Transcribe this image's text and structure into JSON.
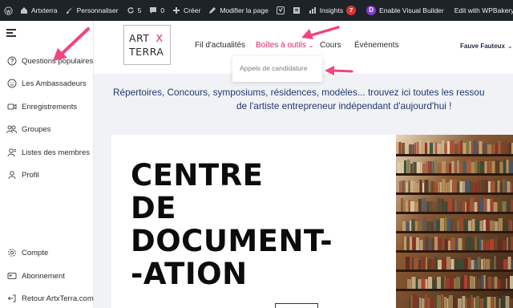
{
  "adminbar": {
    "site_name": "Artxterra",
    "customize": "Personnaliser",
    "updates_count": "5",
    "comments_count": "0",
    "new": "Créer",
    "edit_page": "Modifier la page",
    "insights": "Insights",
    "insights_badge": "7",
    "visual_builder": "Enable Visual Builder",
    "wpbakery": "Edit with WPBakery Page Builder",
    "divi_letter": "D"
  },
  "sidebar": {
    "items": [
      {
        "label": "Questions populaires",
        "icon": "question-circle-icon"
      },
      {
        "label": "Les Ambassadeurs",
        "icon": "smiley-icon"
      },
      {
        "label": "Enregistrements",
        "icon": "video-camera-icon"
      },
      {
        "label": "Groupes",
        "icon": "group-icon"
      },
      {
        "label": "Listes des membres",
        "icon": "members-icon"
      },
      {
        "label": "Profil",
        "icon": "user-icon"
      }
    ],
    "bottom_items": [
      {
        "label": "Compte",
        "icon": "gear-icon"
      },
      {
        "label": "Abonnement",
        "icon": "card-icon"
      },
      {
        "label": "Retour ArtxTerra.com",
        "icon": "exit-icon"
      }
    ]
  },
  "header": {
    "logo_line1": "ART",
    "logo_x": "X",
    "logo_line2": "TERRA",
    "nav": {
      "news": "Fil d'actualités",
      "toolbox": "Boîtes à outils",
      "toolbox_chevron": "⌄",
      "courses": "Cours",
      "events": "Événements"
    },
    "user_name": "Fauve Fauteux"
  },
  "dropdown": {
    "item": "Appels de candidature"
  },
  "intro": {
    "line1": "Répertoires, Concours, symposiums, résidences, modèles... trouvez ici toutes les ressou",
    "line2": "de l'artiste entrepreneur indépendant d'aujourd'hui !"
  },
  "hero": {
    "title_lines": [
      "CENTRE",
      "DE",
      "DOCUMENT-",
      "-ATION"
    ]
  },
  "colors": {
    "accent": "#e0245e",
    "adminbar_bg": "#1d2327",
    "intro_text": "#1e3a6e",
    "arrow": "#f0457d"
  }
}
